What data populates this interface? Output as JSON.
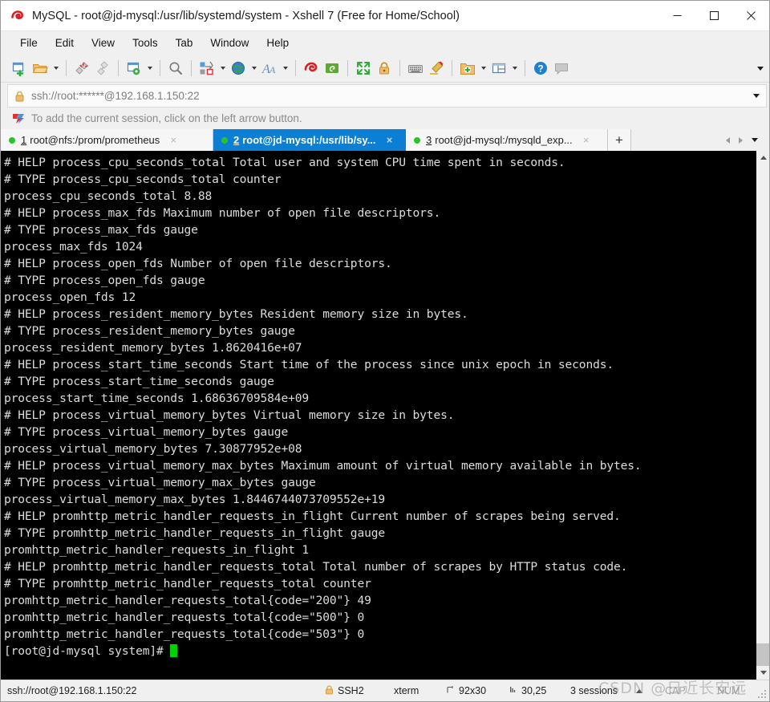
{
  "window": {
    "title": "MySQL - root@jd-mysql:/usr/lib/systemd/system - Xshell 7 (Free for Home/School)",
    "app_icon": "xshell-logo-icon",
    "minimize_label": "Minimize",
    "maximize_label": "Maximize",
    "close_label": "Close"
  },
  "menubar": {
    "items": [
      {
        "label": "File"
      },
      {
        "label": "Edit"
      },
      {
        "label": "View"
      },
      {
        "label": "Tools"
      },
      {
        "label": "Tab"
      },
      {
        "label": "Window"
      },
      {
        "label": "Help"
      }
    ]
  },
  "toolbar": {
    "overflow_label": "Toolbar options",
    "buttons": [
      {
        "name": "new-session-icon",
        "caret": false
      },
      {
        "name": "open-session-icon",
        "caret": true
      },
      {
        "name": "disconnect-icon",
        "caret": false
      },
      {
        "name": "reconnect-icon",
        "caret": false
      },
      {
        "name": "session-properties-icon",
        "caret": true
      },
      {
        "name": "find-icon",
        "caret": false
      },
      {
        "name": "file-transfer-icon",
        "caret": true
      },
      {
        "name": "web-browser-icon",
        "caret": true
      },
      {
        "name": "font-size-icon",
        "caret": true
      },
      {
        "name": "xshell-icon",
        "caret": false
      },
      {
        "name": "xftp-icon",
        "caret": false
      },
      {
        "name": "fullscreen-icon",
        "caret": false
      },
      {
        "name": "lock-icon",
        "caret": false
      },
      {
        "name": "keyboard-icon",
        "caret": false
      },
      {
        "name": "highlight-icon",
        "caret": false
      },
      {
        "name": "new-folder-icon",
        "caret": true
      },
      {
        "name": "layout-icon",
        "caret": true
      },
      {
        "name": "help-icon",
        "caret": false
      },
      {
        "name": "feedback-icon",
        "caret": false
      }
    ]
  },
  "address": {
    "lock_icon": "padlock-icon",
    "value": "ssh://root:******@192.168.1.150:22",
    "placeholder": "ssh://root:******@192.168.1.150:22",
    "dropdown_label": "Address history"
  },
  "notice": {
    "icon": "left-arrow-flag-icon",
    "text": "To add the current session, click on the left arrow button."
  },
  "tabs": {
    "items": [
      {
        "number": "1",
        "label": "root@nfs:/prom/prometheus",
        "active": false,
        "status": "connected"
      },
      {
        "number": "2",
        "label": "root@jd-mysql:/usr/lib/sy...",
        "active": true,
        "status": "connected"
      },
      {
        "number": "3",
        "label": "root@jd-mysql:/mysqld_exp...",
        "active": false,
        "status": "connected"
      }
    ],
    "new_tab_label": "+",
    "close_label": "×",
    "scroll_left_label": "Scroll tabs left",
    "scroll_right_label": "Scroll tabs right",
    "tab_list_label": "Tab list"
  },
  "terminal": {
    "lines": [
      "# HELP process_cpu_seconds_total Total user and system CPU time spent in seconds.",
      "# TYPE process_cpu_seconds_total counter",
      "process_cpu_seconds_total 8.88",
      "# HELP process_max_fds Maximum number of open file descriptors.",
      "# TYPE process_max_fds gauge",
      "process_max_fds 1024",
      "# HELP process_open_fds Number of open file descriptors.",
      "# TYPE process_open_fds gauge",
      "process_open_fds 12",
      "# HELP process_resident_memory_bytes Resident memory size in bytes.",
      "# TYPE process_resident_memory_bytes gauge",
      "process_resident_memory_bytes 1.8620416e+07",
      "# HELP process_start_time_seconds Start time of the process since unix epoch in seconds.",
      "# TYPE process_start_time_seconds gauge",
      "process_start_time_seconds 1.68636709584e+09",
      "# HELP process_virtual_memory_bytes Virtual memory size in bytes.",
      "# TYPE process_virtual_memory_bytes gauge",
      "process_virtual_memory_bytes 7.30877952e+08",
      "# HELP process_virtual_memory_max_bytes Maximum amount of virtual memory available in bytes.",
      "# TYPE process_virtual_memory_max_bytes gauge",
      "process_virtual_memory_max_bytes 1.8446744073709552e+19",
      "# HELP promhttp_metric_handler_requests_in_flight Current number of scrapes being served.",
      "# TYPE promhttp_metric_handler_requests_in_flight gauge",
      "promhttp_metric_handler_requests_in_flight 1",
      "# HELP promhttp_metric_handler_requests_total Total number of scrapes by HTTP status code.",
      "# TYPE promhttp_metric_handler_requests_total counter",
      "promhttp_metric_handler_requests_total{code=\"200\"} 49",
      "promhttp_metric_handler_requests_total{code=\"500\"} 0",
      "promhttp_metric_handler_requests_total{code=\"503\"} 0"
    ],
    "prompt": "[root@jd-mysql system]# ",
    "fg_color": "#dcdcdc",
    "bg_color": "#000000",
    "cursor_color": "#00d200"
  },
  "scrollbar": {
    "up_label": "Scroll up",
    "down_label": "Scroll down",
    "thumb_label": "Scroll thumb"
  },
  "statusbar": {
    "connection": "ssh://root@192.168.1.150:22",
    "security": "SSH2",
    "security_icon": "padlock-icon",
    "terminal_type": "xterm",
    "size_icon": "screen-size-icon",
    "size": "92x30",
    "position_icon": "cursor-position-icon",
    "position": "30,25",
    "sessions": "3 sessions",
    "caps": "CAP",
    "num": "NUM"
  },
  "watermark": {
    "text": "CSDN @日近长安远"
  },
  "colors": {
    "accent": "#0a7fd4",
    "chrome": "#f0f0f0",
    "terminal_bg": "#000000",
    "terminal_fg": "#dcdcdc",
    "cursor": "#00d200",
    "tab_dot": "#2bc32b"
  }
}
